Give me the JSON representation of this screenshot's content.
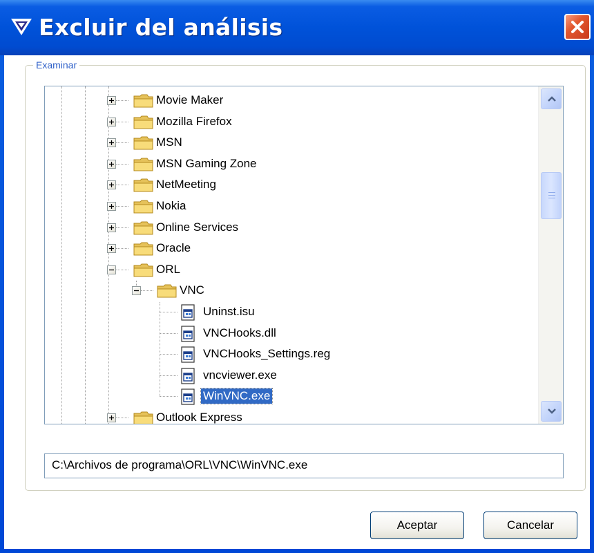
{
  "window": {
    "title": "Excluir del análisis",
    "close_icon": "close-icon"
  },
  "browse_group": {
    "legend": "Examinar"
  },
  "tree": {
    "items": [
      {
        "label": "Movie Maker",
        "type": "folder",
        "expander": "plus"
      },
      {
        "label": "Mozilla Firefox",
        "type": "folder",
        "expander": "plus"
      },
      {
        "label": "MSN",
        "type": "folder",
        "expander": "plus"
      },
      {
        "label": "MSN Gaming Zone",
        "type": "folder",
        "expander": "plus"
      },
      {
        "label": "NetMeeting",
        "type": "folder",
        "expander": "plus"
      },
      {
        "label": "Nokia",
        "type": "folder",
        "expander": "plus"
      },
      {
        "label": "Online Services",
        "type": "folder",
        "expander": "plus"
      },
      {
        "label": "Oracle",
        "type": "folder",
        "expander": "plus"
      },
      {
        "label": "ORL",
        "type": "folder",
        "expander": "minus"
      },
      {
        "label": "VNC",
        "type": "folder",
        "expander": "minus"
      },
      {
        "label": "Uninst.isu",
        "type": "file"
      },
      {
        "label": "VNCHooks.dll",
        "type": "file"
      },
      {
        "label": "VNCHooks_Settings.reg",
        "type": "file"
      },
      {
        "label": "vncviewer.exe",
        "type": "file"
      },
      {
        "label": "WinVNC.exe",
        "type": "file",
        "selected": true
      },
      {
        "label": "Outlook Express",
        "type": "folder",
        "expander": "plus"
      }
    ]
  },
  "path_field": {
    "value": "C:\\Archivos de programa\\ORL\\VNC\\WinVNC.exe"
  },
  "buttons": {
    "ok_label": "Aceptar",
    "cancel_label": "Cancelar"
  },
  "colors": {
    "title_bar": "#0052d9",
    "selection": "#316ac5",
    "legend_text": "#2d5fc8",
    "close_button": "#e2572e"
  }
}
